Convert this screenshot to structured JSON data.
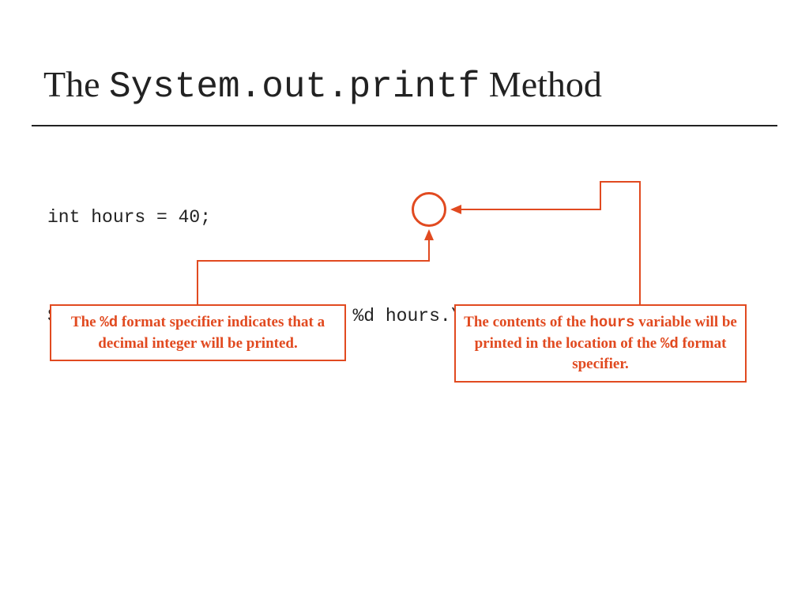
{
  "title": {
    "prefix": "The ",
    "mono": "System.out.printf",
    "suffix": " Method"
  },
  "code": {
    "line1": "int hours = 40;",
    "line2": "System.out.printf(\"I worked %d hours.\\n\", hours);"
  },
  "callouts": {
    "left": {
      "part1": "The ",
      "mono1": "%d",
      "part2": " format specifier indicates that a decimal integer will be printed."
    },
    "right": {
      "part1": "The contents of the ",
      "mono1": "hours",
      "part2": " variable will be printed in the location of the ",
      "mono2": "%d",
      "part3": " format specifier."
    }
  },
  "colors": {
    "accent": "#e14a20",
    "text": "#222222"
  }
}
